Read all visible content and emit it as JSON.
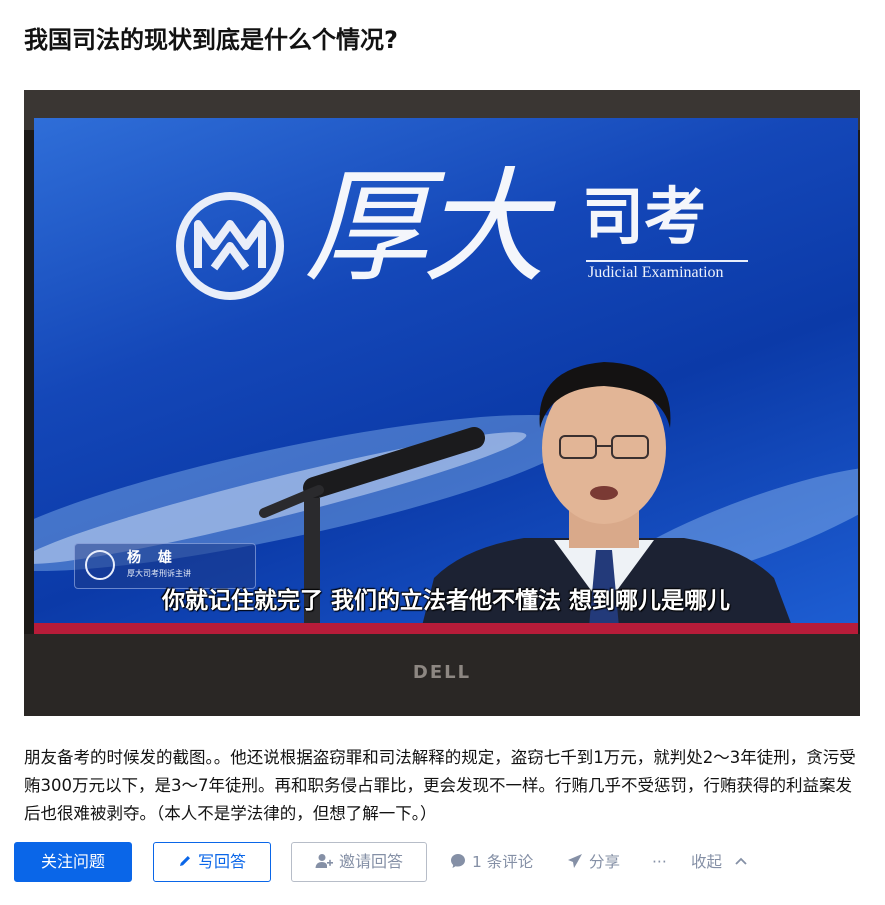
{
  "question": {
    "title": "我国司法的现状到底是什么个情况?"
  },
  "photo": {
    "brand_mark_text": "厚大",
    "brand_sub_text": "司考",
    "brand_en_text": "Judicial Examination",
    "nameplate_name": "杨 雄",
    "nameplate_role": "厚大司考刑诉主讲",
    "subtitle": "你就记住就完了 我们的立法者他不懂法 想到哪儿是哪儿",
    "laptop_brand": "DELL"
  },
  "description": "朋友备考的时候发的截图。。他还说根据盗窃罪和司法解释的规定，盗窃七千到1万元，就判处2～3年徒刑，贪污受贿300万元以下，是3～7年徒刑。再和职务侵占罪比，更会发现不一样。行贿几乎不受惩罚，行贿获得的利益案发后也很难被剥夺。（本人不是学法律的，但想了解一下。）",
  "actions": {
    "follow_label": "关注问题",
    "write_answer_label": "写回答",
    "invite_label": "邀请回答",
    "comments_label": "1 条评论",
    "share_label": "分享",
    "more_label": "···",
    "collapse_label": "收起"
  },
  "colors": {
    "primary": "#0a66e8",
    "muted": "#8590a6",
    "text": "#121212"
  }
}
